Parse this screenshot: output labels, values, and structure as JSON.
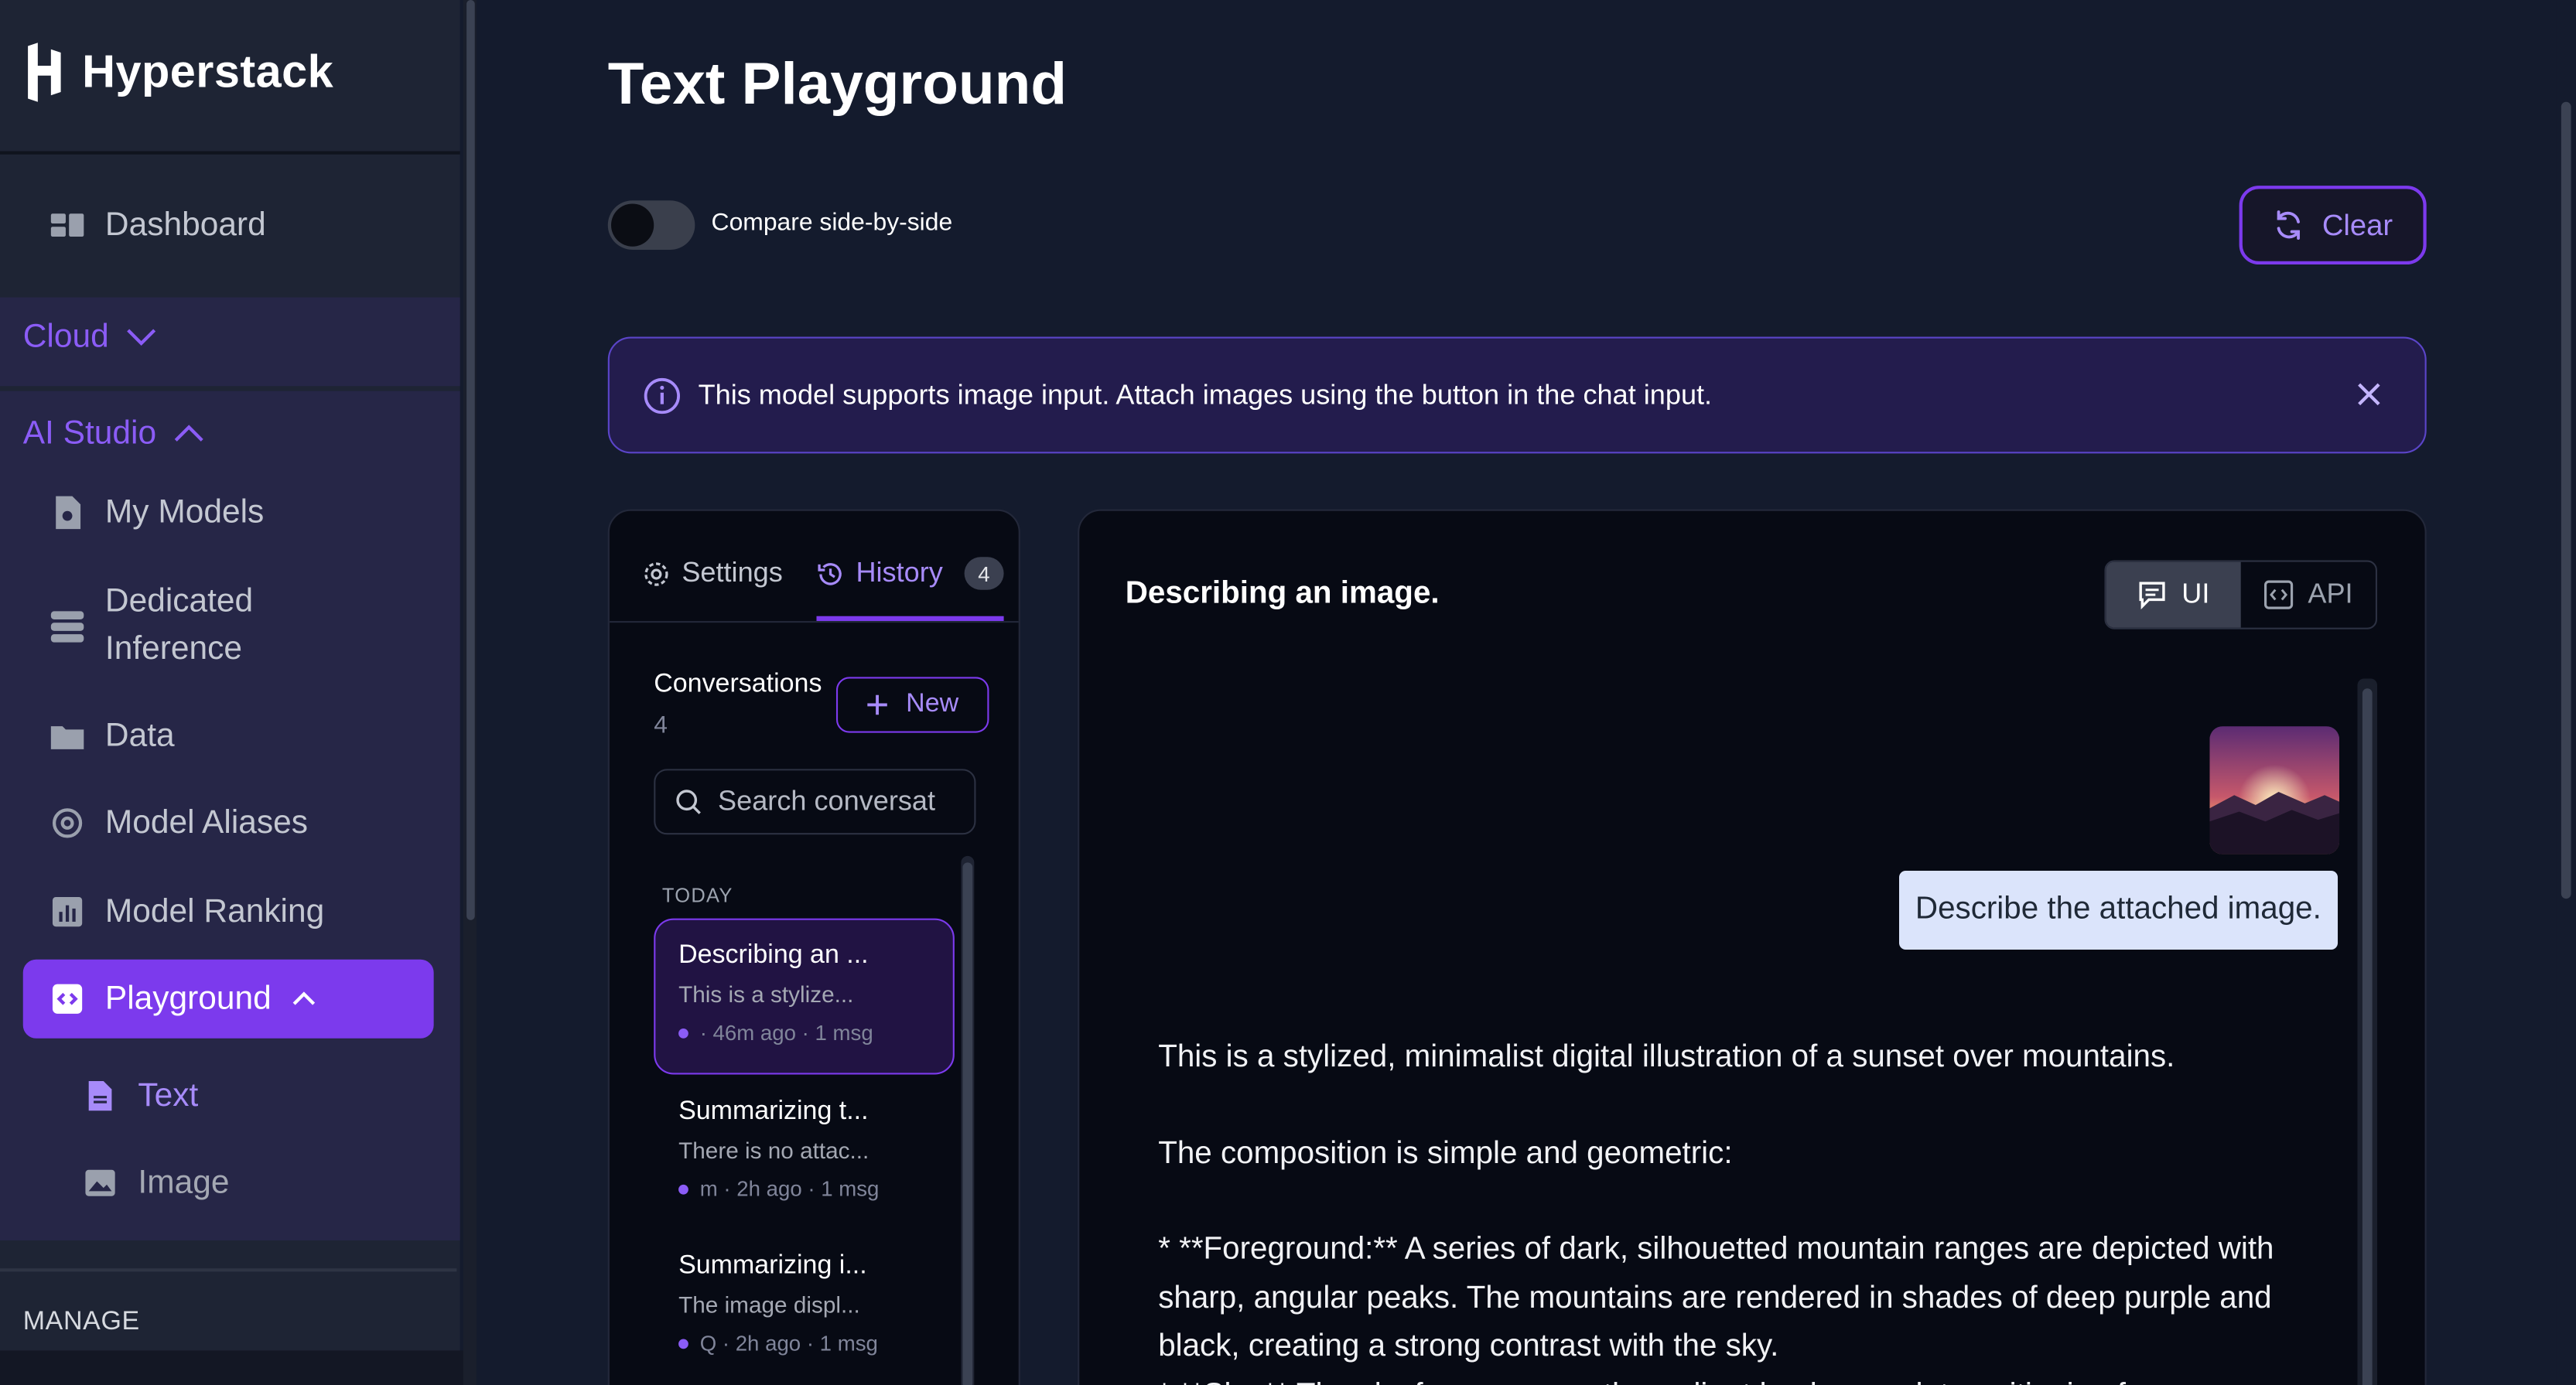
{
  "app": {
    "name": "Hyperstack"
  },
  "sidebar": {
    "dashboard": "Dashboard",
    "cloud": "Cloud",
    "ai_studio": "AI Studio",
    "items": [
      {
        "label": "My Models",
        "icon": "model-file-icon"
      },
      {
        "label": "Dedicated\nInference",
        "icon": "server-stack-icon"
      },
      {
        "label": "Data",
        "icon": "folder-icon"
      },
      {
        "label": "Model Aliases",
        "icon": "at-sign-icon"
      },
      {
        "label": "Model Ranking",
        "icon": "bar-chart-icon"
      }
    ],
    "playground": "Playground",
    "sub_items": [
      {
        "label": "Text",
        "icon": "text-file-icon"
      },
      {
        "label": "Image",
        "icon": "image-icon"
      }
    ],
    "manage": "MANAGE"
  },
  "page": {
    "title": "Text Playground",
    "compare_label": "Compare side-by-side",
    "compare_on": false,
    "clear_label": "Clear"
  },
  "banner": {
    "text": "This model supports image input. Attach images using the button in the chat input."
  },
  "history_panel": {
    "tabs": {
      "settings": "Settings",
      "history": "History",
      "history_count": "4"
    },
    "conversations_title": "Conversations",
    "conversations_count": "4",
    "new_label": "New",
    "search_placeholder": "Search conversat",
    "group_label": "TODAY",
    "items": [
      {
        "title": "Describing an ...",
        "snippet": "This is a stylize...",
        "meta": "· 46m ago · 1 msg"
      },
      {
        "title": "Summarizing t...",
        "snippet": "There is no attac...",
        "meta": "m · 2h ago · 1 msg"
      },
      {
        "title": "Summarizing i...",
        "snippet": "The image displ...",
        "meta": "Q · 2h ago · 1 msg"
      }
    ]
  },
  "chat": {
    "title": "Describing an image.",
    "view_ui": "UI",
    "view_api": "API",
    "user_message": "Describe the attached image.",
    "answer_p1": "This is a stylized, minimalist digital illustration of a sunset over mountains.",
    "answer_p2": "The composition is simple and geometric:",
    "answer_li1": "*   **Foreground:** A series of dark, silhouetted mountain ranges are depicted with sharp, angular peaks. The mountains are rendered in shades of deep purple and black, creating a strong contrast with the sky.",
    "answer_li2": "*   **Sky:** The sky forms a smooth gradient background, transitioning from"
  },
  "colors": {
    "accent": "#7c3aed",
    "accent_light": "#a78bfa",
    "sidebar_bg": "#1e2434",
    "main_bg": "#141b2d",
    "panel_bg": "#070a14",
    "banner_bg": "#231c4d"
  }
}
